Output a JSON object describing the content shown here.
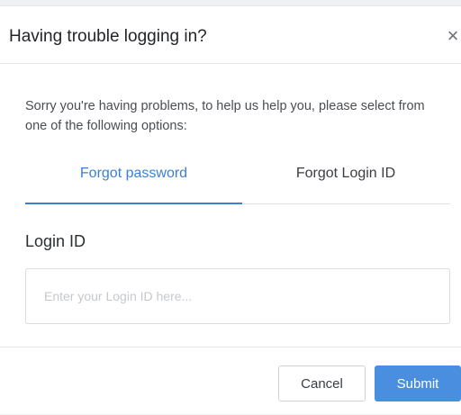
{
  "modal": {
    "title": "Having trouble logging in?",
    "close_glyph": "×",
    "intro": "Sorry you're having problems, to help us help you, please select from one of the following options:"
  },
  "tabs": [
    {
      "label": "Forgot password",
      "active": true
    },
    {
      "label": "Forgot Login ID",
      "active": false
    }
  ],
  "form": {
    "label": "Login ID",
    "value": "",
    "placeholder": "Enter your Login ID here..."
  },
  "footer": {
    "cancel_label": "Cancel",
    "submit_label": "Submit"
  },
  "colors": {
    "accent": "#3b80d6",
    "primary_button": "#4a8fdf"
  }
}
